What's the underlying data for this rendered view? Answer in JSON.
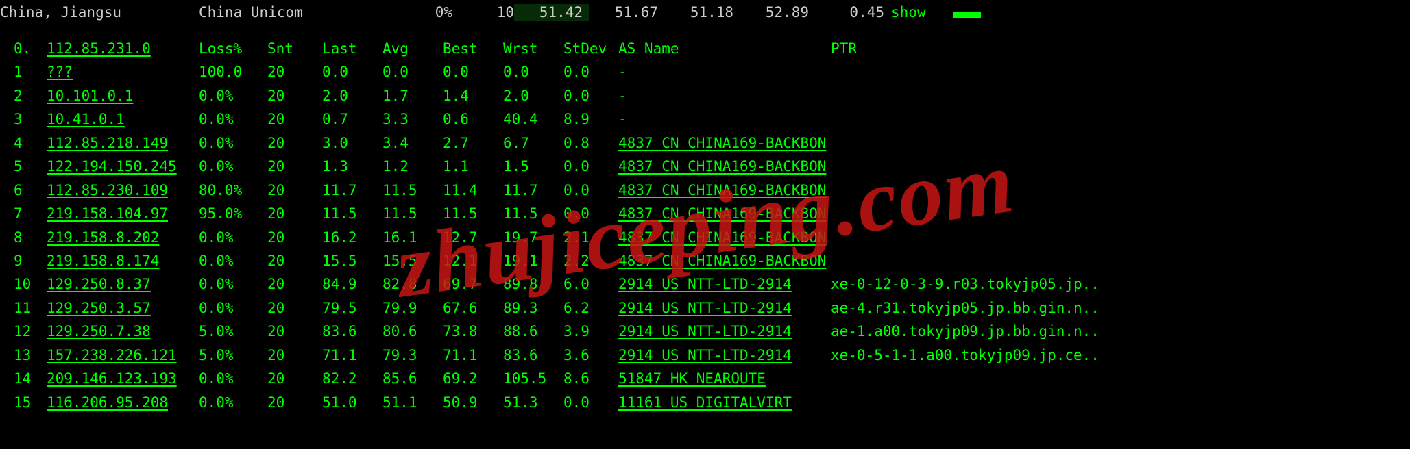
{
  "topbar": {
    "location": "China, Jiangsu",
    "isp": "China Unicom",
    "percent": "0%",
    "count": "10",
    "metrics": [
      "51.42",
      "51.67",
      "51.18",
      "52.89",
      "0.45"
    ],
    "highlight_index": 0,
    "show": "show"
  },
  "columns": {
    "hop": "0.",
    "ip": "112.85.231.0",
    "loss": "Loss%",
    "snt": "Snt",
    "last": "Last",
    "avg": "Avg",
    "best": "Best",
    "wrst": "Wrst",
    "stdev": "StDev",
    "as": "AS Name",
    "ptr": "PTR"
  },
  "rows": [
    {
      "hop": "1",
      "ip": "???",
      "loss": "100.0",
      "snt": "20",
      "last": "0.0",
      "avg": "0.0",
      "best": "0.0",
      "wrst": "0.0",
      "stdev": "0.0",
      "as": "-",
      "ptr": ""
    },
    {
      "hop": "2",
      "ip": "10.101.0.1",
      "loss": "0.0%",
      "snt": "20",
      "last": "2.0",
      "avg": "1.7",
      "best": "1.4",
      "wrst": "2.0",
      "stdev": "0.0",
      "as": "-",
      "ptr": ""
    },
    {
      "hop": "3",
      "ip": "10.41.0.1",
      "loss": "0.0%",
      "snt": "20",
      "last": "0.7",
      "avg": "3.3",
      "best": "0.6",
      "wrst": "40.4",
      "stdev": "8.9",
      "as": "-",
      "ptr": ""
    },
    {
      "hop": "4",
      "ip": "112.85.218.149",
      "loss": "0.0%",
      "snt": "20",
      "last": "3.0",
      "avg": "3.4",
      "best": "2.7",
      "wrst": "6.7",
      "stdev": "0.8",
      "as": "4837  CN CHINA169-BACKBON",
      "ptr": ""
    },
    {
      "hop": "5",
      "ip": "122.194.150.245",
      "loss": "0.0%",
      "snt": "20",
      "last": "1.3",
      "avg": "1.2",
      "best": "1.1",
      "wrst": "1.5",
      "stdev": "0.0",
      "as": "4837  CN CHINA169-BACKBON",
      "ptr": ""
    },
    {
      "hop": "6",
      "ip": "112.85.230.109",
      "loss": "80.0%",
      "snt": "20",
      "last": "11.7",
      "avg": "11.5",
      "best": "11.4",
      "wrst": "11.7",
      "stdev": "0.0",
      "as": "4837  CN CHINA169-BACKBON",
      "ptr": ""
    },
    {
      "hop": "7",
      "ip": "219.158.104.97",
      "loss": "95.0%",
      "snt": "20",
      "last": "11.5",
      "avg": "11.5",
      "best": "11.5",
      "wrst": "11.5",
      "stdev": "0.0",
      "as": "4837  CN CHINA169-BACKBON",
      "ptr": ""
    },
    {
      "hop": "8",
      "ip": "219.158.8.202",
      "loss": "0.0%",
      "snt": "20",
      "last": "16.2",
      "avg": "16.1",
      "best": "12.7",
      "wrst": "19.7",
      "stdev": "2.1",
      "as": "4837  CN CHINA169-BACKBON",
      "ptr": ""
    },
    {
      "hop": "9",
      "ip": "219.158.8.174",
      "loss": "0.0%",
      "snt": "20",
      "last": "15.5",
      "avg": "15.5",
      "best": "12.1",
      "wrst": "19.1",
      "stdev": "2.2",
      "as": "4837  CN CHINA169-BACKBON",
      "ptr": ""
    },
    {
      "hop": "10",
      "ip": "129.250.8.37",
      "loss": "0.0%",
      "snt": "20",
      "last": "84.9",
      "avg": "82.8",
      "best": "69.7",
      "wrst": "89.8",
      "stdev": "6.0",
      "as": "2914  US NTT-LTD-2914",
      "ptr": "xe-0-12-0-3-9.r03.tokyjp05.jp.."
    },
    {
      "hop": "11",
      "ip": "129.250.3.57",
      "loss": "0.0%",
      "snt": "20",
      "last": "79.5",
      "avg": "79.9",
      "best": "67.6",
      "wrst": "89.3",
      "stdev": "6.2",
      "as": "2914  US NTT-LTD-2914",
      "ptr": "ae-4.r31.tokyjp05.jp.bb.gin.n.."
    },
    {
      "hop": "12",
      "ip": "129.250.7.38",
      "loss": "5.0%",
      "snt": "20",
      "last": "83.6",
      "avg": "80.6",
      "best": "73.8",
      "wrst": "88.6",
      "stdev": "3.9",
      "as": "2914  US NTT-LTD-2914",
      "ptr": "ae-1.a00.tokyjp09.jp.bb.gin.n.."
    },
    {
      "hop": "13",
      "ip": "157.238.226.121",
      "loss": "5.0%",
      "snt": "20",
      "last": "71.1",
      "avg": "79.3",
      "best": "71.1",
      "wrst": "83.6",
      "stdev": "3.6",
      "as": "2914  US NTT-LTD-2914",
      "ptr": "xe-0-5-1-1.a00.tokyjp09.jp.ce.."
    },
    {
      "hop": "14",
      "ip": "209.146.123.193",
      "loss": "0.0%",
      "snt": "20",
      "last": "82.2",
      "avg": "85.6",
      "best": "69.2",
      "wrst": "105.5",
      "stdev": "8.6",
      "as": "51847 HK NEAROUTE",
      "ptr": ""
    },
    {
      "hop": "15",
      "ip": "116.206.95.208",
      "loss": "0.0%",
      "snt": "20",
      "last": "51.0",
      "avg": "51.1",
      "best": "50.9",
      "wrst": "51.3",
      "stdev": "0.0",
      "as": "11161 US DIGITALVIRT",
      "ptr": ""
    }
  ],
  "watermark": "zhujiceping.com"
}
